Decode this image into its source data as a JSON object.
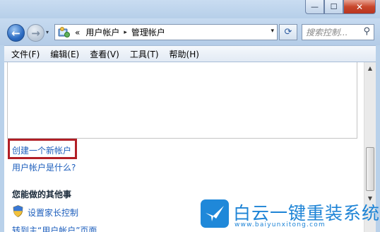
{
  "window": {
    "minimize_glyph": "—",
    "maximize_glyph": "☐",
    "close_glyph": "✕"
  },
  "nav": {
    "back_glyph": "←",
    "forward_glyph": "→",
    "history_glyph": "▾",
    "breadcrumb_prefix": "«",
    "breadcrumb": [
      "用户帐户",
      "管理帐户"
    ],
    "breadcrumb_sep": "▸",
    "address_dropdown_glyph": "▾",
    "refresh_glyph": "⟳",
    "search_placeholder": "搜索控制...",
    "search_icon_glyph": "⚲"
  },
  "menubar": {
    "items": [
      "文件(F)",
      "编辑(E)",
      "查看(V)",
      "工具(T)",
      "帮助(H)"
    ]
  },
  "content": {
    "create_account_link": "创建一个新帐户",
    "what_is_account_link": "用户帐户是什么?",
    "other_things_heading": "您能做的其他事",
    "parental_controls_link": "设置家长控制",
    "goto_main_link": "转到主“用户帐户”页面",
    "scroll_up_glyph": "▲",
    "scroll_down_glyph": "▼"
  },
  "watermark": {
    "name": "白云一键重装系统",
    "url": "www.baiyunxitong.com"
  },
  "colors": {
    "link": "#1e5fbd",
    "highlight_box": "#b21f26",
    "watermark": "#1e84d6"
  }
}
